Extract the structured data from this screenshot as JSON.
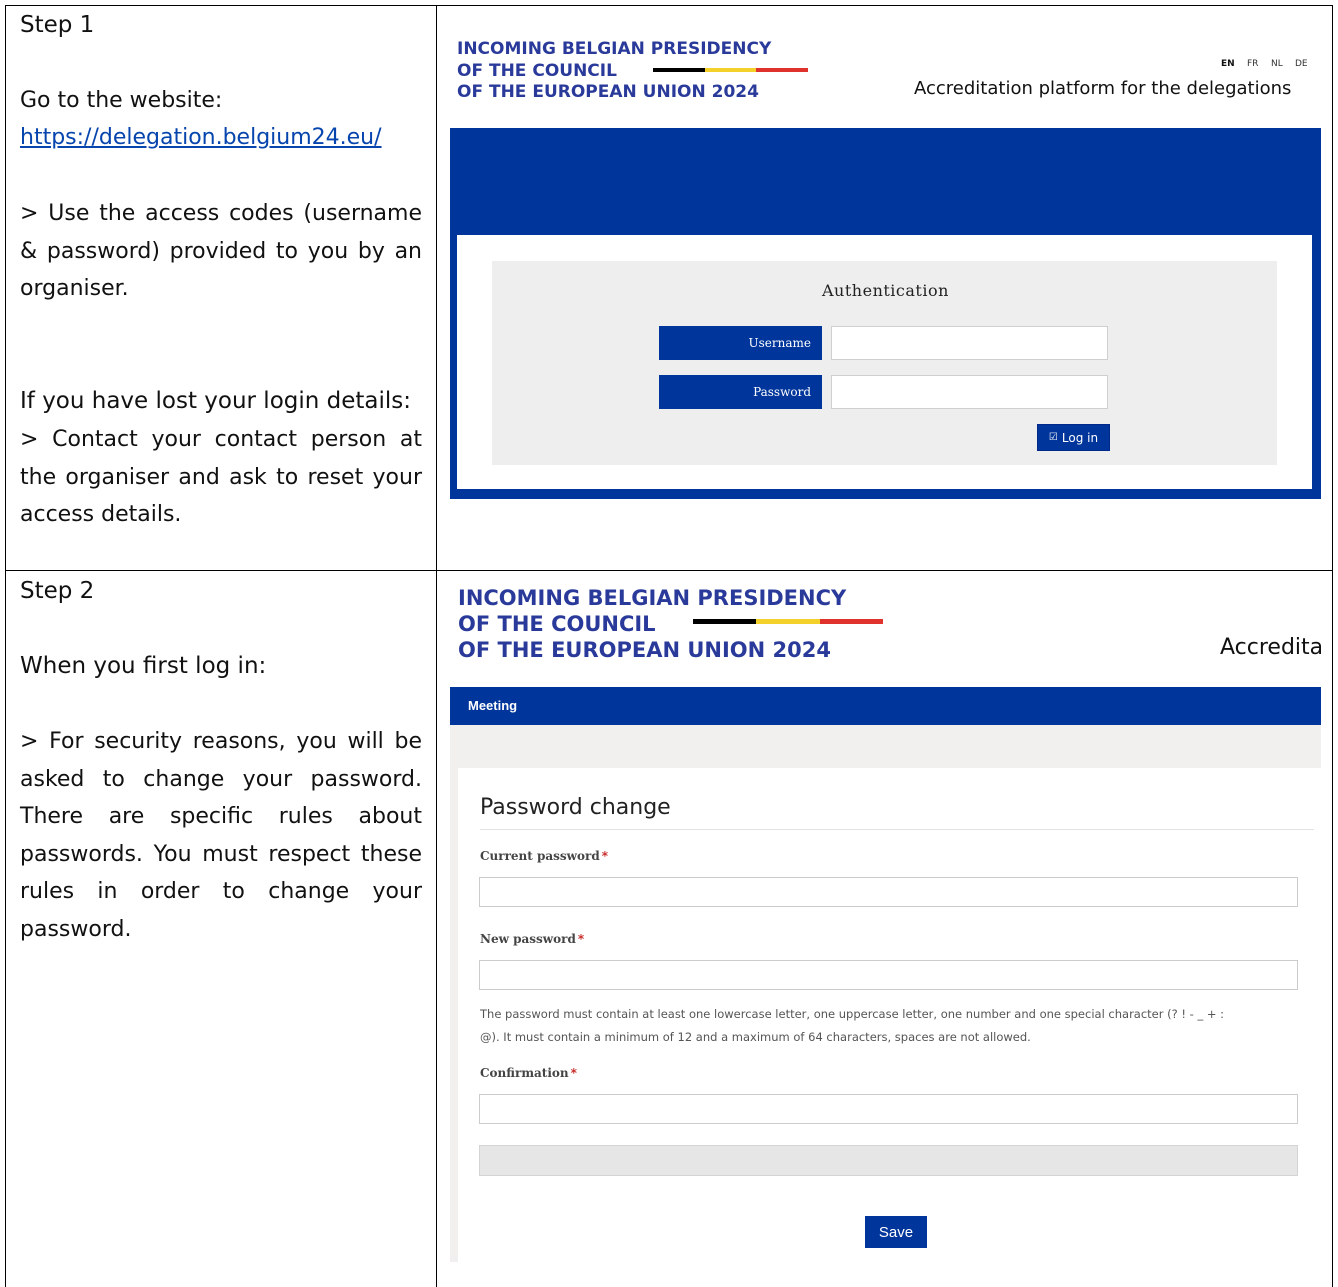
{
  "step1": {
    "heading": "Step 1",
    "goto_text": "Go to the website:",
    "url": "https://delegation.belgium24.eu/",
    "access_text": "> Use the access codes (username & password) provided to you by an organiser.",
    "lost_heading": "If you have lost your login details:",
    "lost_text": "> Contact your contact person at the organiser and ask to reset your access details."
  },
  "step2": {
    "heading": "Step 2",
    "first_login": "When you first log in:",
    "security_text": "> For security reasons, you will be asked to change your password. There are specific rules about passwords. You must respect these rules in order to change your password."
  },
  "logo": {
    "line1": "INCOMING BELGIAN PRESIDENCY",
    "line2": "OF THE COUNCIL",
    "line3": "OF THE EUROPEAN UNION 2024"
  },
  "screen1": {
    "languages": [
      "EN",
      "FR",
      "NL",
      "DE"
    ],
    "platform_title": "Accreditation platform for the delegations",
    "auth_title": "Authentication",
    "username_label": "Username",
    "password_label": "Password",
    "login_button": "Log in"
  },
  "screen2": {
    "platform_title_clipped": "Accredita",
    "menu_item": "Meeting",
    "form_title": "Password change",
    "current_password_label": "Current password",
    "new_password_label": "New password",
    "help_line1": "The password must contain at least one lowercase letter, one uppercase letter, one number and one special character (? ! - _ + :",
    "help_line2": "@). It must contain a minimum of 12 and a maximum of 64 characters, spaces are not allowed.",
    "confirmation_label": "Confirmation",
    "required_marker": "*",
    "save_button": "Save"
  },
  "colors": {
    "brand_blue": "#00359b",
    "logo_blue": "#2a3a9a",
    "flag_black": "#000000",
    "flag_yellow": "#f3d12a",
    "flag_red": "#e0322c",
    "required_red": "#c9302c"
  }
}
